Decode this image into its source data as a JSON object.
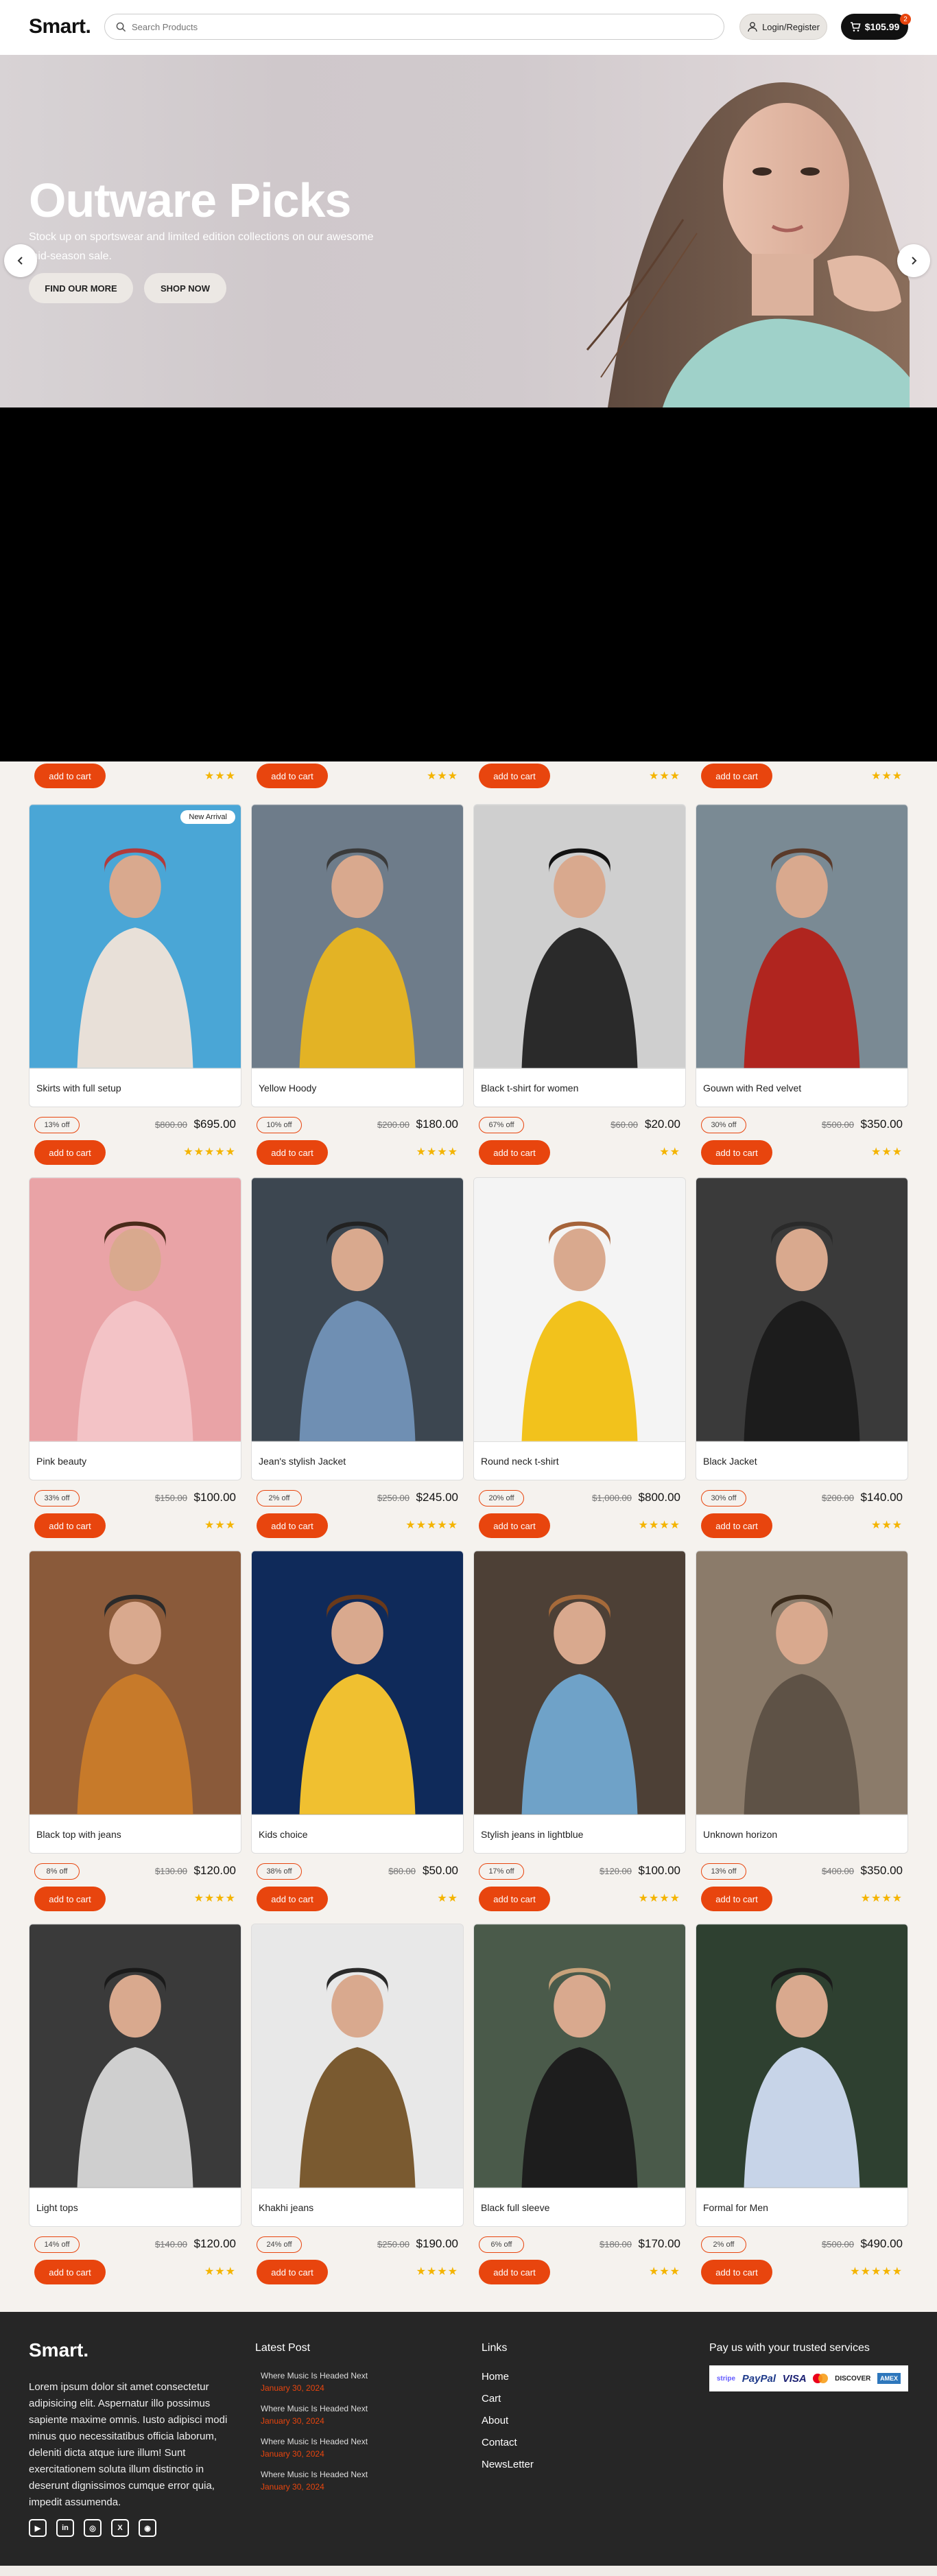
{
  "header": {
    "logo": "Smart.",
    "search_placeholder": "Search Products",
    "login_label": "Login/Register",
    "cart_total": "$105.99",
    "cart_count": "2"
  },
  "hero": {
    "title": "Outware Picks",
    "subtitle": "Stock up on sportswear and limited edition collections on our awesome mid-season sale.",
    "btn_primary": "FIND OUR MORE",
    "btn_secondary": "SHOP NOW"
  },
  "partial_row": {
    "add_label": "add to cart",
    "stars": [
      "★★★",
      "★★★",
      "★★★",
      "★★★"
    ]
  },
  "products": [
    {
      "name": "Skirts with full setup",
      "discount": "13% off",
      "old": "$800.00",
      "price": "$695.00",
      "stars": "★★★★★",
      "badge": "New Arrival"
    },
    {
      "name": "Yellow Hoody",
      "discount": "10% off",
      "old": "$200.00",
      "price": "$180.00",
      "stars": "★★★★"
    },
    {
      "name": "Black t-shirt for women",
      "discount": "67% off",
      "old": "$60.00",
      "price": "$20.00",
      "stars": "★★"
    },
    {
      "name": "Gouwn with Red velvet",
      "discount": "30% off",
      "old": "$500.00",
      "price": "$350.00",
      "stars": "★★★"
    },
    {
      "name": "Pink beauty",
      "discount": "33% off",
      "old": "$150.00",
      "price": "$100.00",
      "stars": "★★★"
    },
    {
      "name": "Jean's stylish Jacket",
      "discount": "2% off",
      "old": "$250.00",
      "price": "$245.00",
      "stars": "★★★★★"
    },
    {
      "name": "Round neck t-shirt",
      "discount": "20% off",
      "old": "$1,000.00",
      "price": "$800.00",
      "stars": "★★★★"
    },
    {
      "name": "Black Jacket",
      "discount": "30% off",
      "old": "$200.00",
      "price": "$140.00",
      "stars": "★★★"
    },
    {
      "name": "Black top with jeans",
      "discount": "8% off",
      "old": "$130.00",
      "price": "$120.00",
      "stars": "★★★★"
    },
    {
      "name": "Kids choice",
      "discount": "38% off",
      "old": "$80.00",
      "price": "$50.00",
      "stars": "★★"
    },
    {
      "name": "Stylish jeans in lightblue",
      "discount": "17% off",
      "old": "$120.00",
      "price": "$100.00",
      "stars": "★★★★"
    },
    {
      "name": "Unknown horizon",
      "discount": "13% off",
      "old": "$400.00",
      "price": "$350.00",
      "stars": "★★★★"
    },
    {
      "name": "Light tops",
      "discount": "14% off",
      "old": "$140.00",
      "price": "$120.00",
      "stars": "★★★"
    },
    {
      "name": "Khakhi jeans",
      "discount": "24% off",
      "old": "$250.00",
      "price": "$190.00",
      "stars": "★★★★"
    },
    {
      "name": "Black full sleeve",
      "discount": "6% off",
      "old": "$180.00",
      "price": "$170.00",
      "stars": "★★★"
    },
    {
      "name": "Formal for Men",
      "discount": "2% off",
      "old": "$500.00",
      "price": "$490.00",
      "stars": "★★★★★"
    }
  ],
  "add_to_cart_label": "add to cart",
  "footer": {
    "logo": "Smart.",
    "about": "Lorem ipsum dolor sit amet consectetur adipisicing elit. Aspernatur illo possimus sapiente maxime omnis. Iusto adipisci modi minus quo necessitatibus officia laborum, deleniti dicta atque iure illum! Sunt exercitationem soluta illum distinctio in deserunt dignissimos cumque error quia, impedit assumenda.",
    "latest_title": "Latest Post",
    "posts": [
      {
        "title": "Where Music Is Headed Next",
        "date": "January 30, 2024"
      },
      {
        "title": "Where Music Is Headed Next",
        "date": "January 30, 2024"
      },
      {
        "title": "Where Music Is Headed Next",
        "date": "January 30, 2024"
      },
      {
        "title": "Where Music Is Headed Next",
        "date": "January 30, 2024"
      }
    ],
    "links_title": "Links",
    "links": [
      "Home",
      "Cart",
      "About",
      "Contact",
      "NewsLetter"
    ],
    "pay_title": "Pay us with your trusted services",
    "pay_methods": [
      "stripe",
      "PayPal",
      "VISA",
      "mastercard",
      "DISCOVER",
      "AMEX"
    ]
  },
  "colors": {
    "accent": "#e8450e",
    "footer_bg": "#262626",
    "page_bg": "#f5f2ee",
    "star": "#f4b400"
  }
}
